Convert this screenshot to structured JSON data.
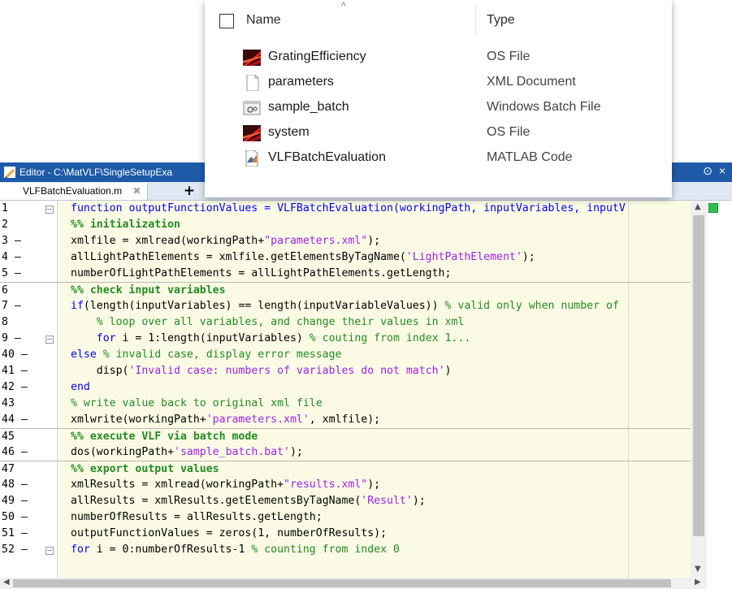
{
  "explorer": {
    "header": {
      "name_label": "Name",
      "type_label": "Type",
      "sort_caret": "^"
    },
    "files": [
      {
        "name": "GratingEfficiency",
        "type": "OS File",
        "icon": "os-file-icon"
      },
      {
        "name": "parameters",
        "type": "XML Document",
        "icon": "xml-document-icon"
      },
      {
        "name": "sample_batch",
        "type": "Windows Batch File",
        "icon": "batch-file-icon"
      },
      {
        "name": "system",
        "type": "OS File",
        "icon": "os-file-icon"
      },
      {
        "name": "VLFBatchEvaluation",
        "type": "MATLAB Code",
        "icon": "matlab-code-icon"
      }
    ]
  },
  "editor": {
    "title": "Editor - C:\\MatVLF\\SingleSetupExa",
    "tab": {
      "label": "VLFBatchEvaluation.m",
      "close": "✖",
      "add": "+"
    },
    "title_buttons": {
      "menu": "⊙",
      "close": "×"
    },
    "colors": {
      "titlebar": "#1e5aa8",
      "code_bg": "#fbfbe5",
      "keyword": "#0000ff",
      "comment": "#228b22",
      "string": "#a020f0"
    },
    "lines": [
      {
        "num": "1",
        "code": "function outputFunctionValues = VLFBatchEvaluation(workingPath, inputVariables, inputV"
      },
      {
        "num": "2",
        "code": "%% initialization"
      },
      {
        "num": "3 —",
        "code": "xmlfile = xmlread(workingPath+\"parameters.xml\");"
      },
      {
        "num": "4 —",
        "code": "allLightPathElements = xmlfile.getElementsByTagName('LightPathElement');"
      },
      {
        "num": "5 —",
        "code": "numberOfLightPathElements = allLightPathElements.getLength;"
      },
      {
        "num": "6",
        "code": "%% check input variables"
      },
      {
        "num": "7 —",
        "code": "if(length(inputVariables) == length(inputVariableValues)) % valid only when number of"
      },
      {
        "num": "8",
        "code": "    % loop over all variables, and change their values in xml"
      },
      {
        "num": "9 —",
        "code": "    for i = 1:length(inputVariables) % couting from index 1..."
      },
      {
        "num": "40 —",
        "code": "else % invalid case, display error message"
      },
      {
        "num": "41 —",
        "code": "    disp('Invalid case: numbers of variables do not match')"
      },
      {
        "num": "42 —",
        "code": "end"
      },
      {
        "num": "43",
        "code": "% write value back to original xml file"
      },
      {
        "num": "44 —",
        "code": "xmlwrite(workingPath+'parameters.xml', xmlfile);"
      },
      {
        "num": "45",
        "code": "%% execute VLF via batch mode"
      },
      {
        "num": "46 —",
        "code": "dos(workingPath+'sample_batch.bat');"
      },
      {
        "num": "47",
        "code": "%% export output values"
      },
      {
        "num": "48 —",
        "code": "xmlResults = xmlread(workingPath+\"results.xml\");"
      },
      {
        "num": "49 —",
        "code": "allResults = xmlResults.getElementsByTagName('Result');"
      },
      {
        "num": "50 —",
        "code": "numberOfResults = allResults.getLength;"
      },
      {
        "num": "51 —",
        "code": "outputFunctionValues = zeros(1, numberOfResults);"
      },
      {
        "num": "52 —",
        "code": "for i = 0:numberOfResults-1 % counting from index 0"
      }
    ]
  }
}
